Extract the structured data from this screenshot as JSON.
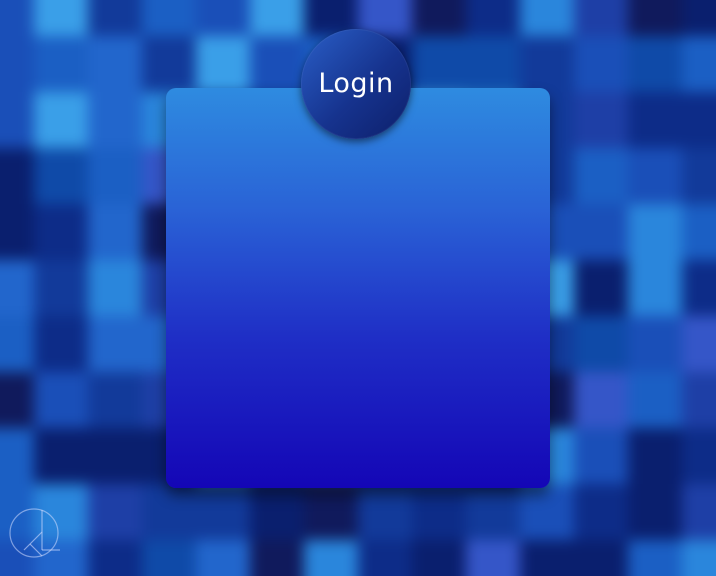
{
  "login": {
    "title": "Login"
  },
  "colors": {
    "card_top": "#2e8be0",
    "card_bottom": "#1406b6",
    "badge": "#16338e",
    "background": "#0b2a78"
  },
  "icons": {
    "watermark": "kl-logo-icon"
  }
}
